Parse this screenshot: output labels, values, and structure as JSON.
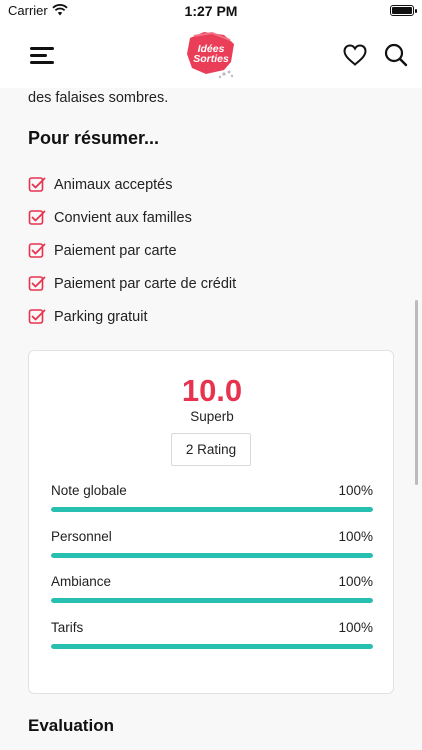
{
  "status_bar": {
    "carrier": "Carrier",
    "time": "1:27 PM"
  },
  "header": {
    "logo_text": "Idées Sorties",
    "logo_line1": "Idées",
    "logo_line2": "Sorties"
  },
  "content": {
    "intro_tail": "des falaises sombres.",
    "summary_title": "Pour résumer...",
    "features": [
      "Animaux acceptés",
      "Convient aux familles",
      "Paiement par carte",
      "Paiement par carte de crédit",
      "Parking gratuit"
    ]
  },
  "rating": {
    "score": "10.0",
    "score_label": "Superb",
    "count_label": "2 Rating",
    "criteria": [
      {
        "label": "Note globale",
        "percent_text": "100%",
        "value": 1.0
      },
      {
        "label": "Personnel",
        "percent_text": "100%",
        "value": 1.0
      },
      {
        "label": "Ambiance",
        "percent_text": "100%",
        "value": 1.0
      },
      {
        "label": "Tarifs",
        "percent_text": "100%",
        "value": 1.0
      }
    ]
  },
  "evaluation": {
    "title": "Evaluation"
  },
  "colors": {
    "accent": "#e8334f",
    "progress": "#26bfb0",
    "check": "#e8334f"
  },
  "icons": [
    "wifi-icon",
    "battery-icon",
    "menu-icon",
    "heart-icon",
    "search-icon",
    "checkbox-check-icon"
  ]
}
